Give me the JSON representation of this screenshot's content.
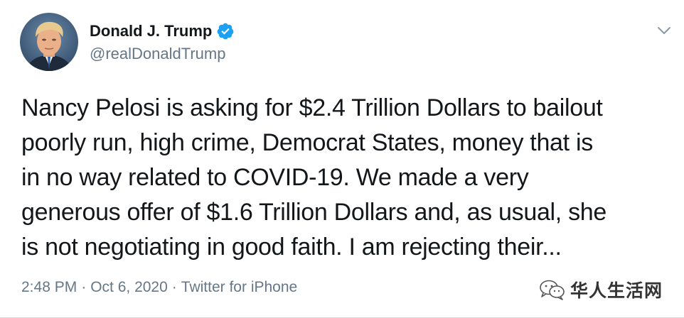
{
  "author": {
    "display_name": "Donald J. Trump",
    "handle": "@realDonaldTrump",
    "verified": true,
    "avatar_icon": "profile-photo",
    "verified_icon": "verified-badge-icon",
    "verified_color": "#1da1f2"
  },
  "menu": {
    "icon": "chevron-down-icon"
  },
  "tweet": {
    "lines": [
      "Nancy Pelosi is asking for $2.4 Trillion Dollars to bailout",
      "poorly run, high crime, Democrat States, money that is",
      "in no way related to COVID-19. We made a very",
      "generous offer of $1.6 Trillion Dollars and, as usual, she",
      "is not negotiating in good faith. I am rejecting their..."
    ]
  },
  "meta": {
    "time": "2:48 PM",
    "separator": "·",
    "date": "Oct 6, 2020",
    "source": "Twitter for iPhone"
  },
  "watermark": {
    "icon": "wechat-icon",
    "text": "华人生活网"
  },
  "colors": {
    "text": "#14171a",
    "secondary": "#657786",
    "accent": "#1da1f2"
  }
}
